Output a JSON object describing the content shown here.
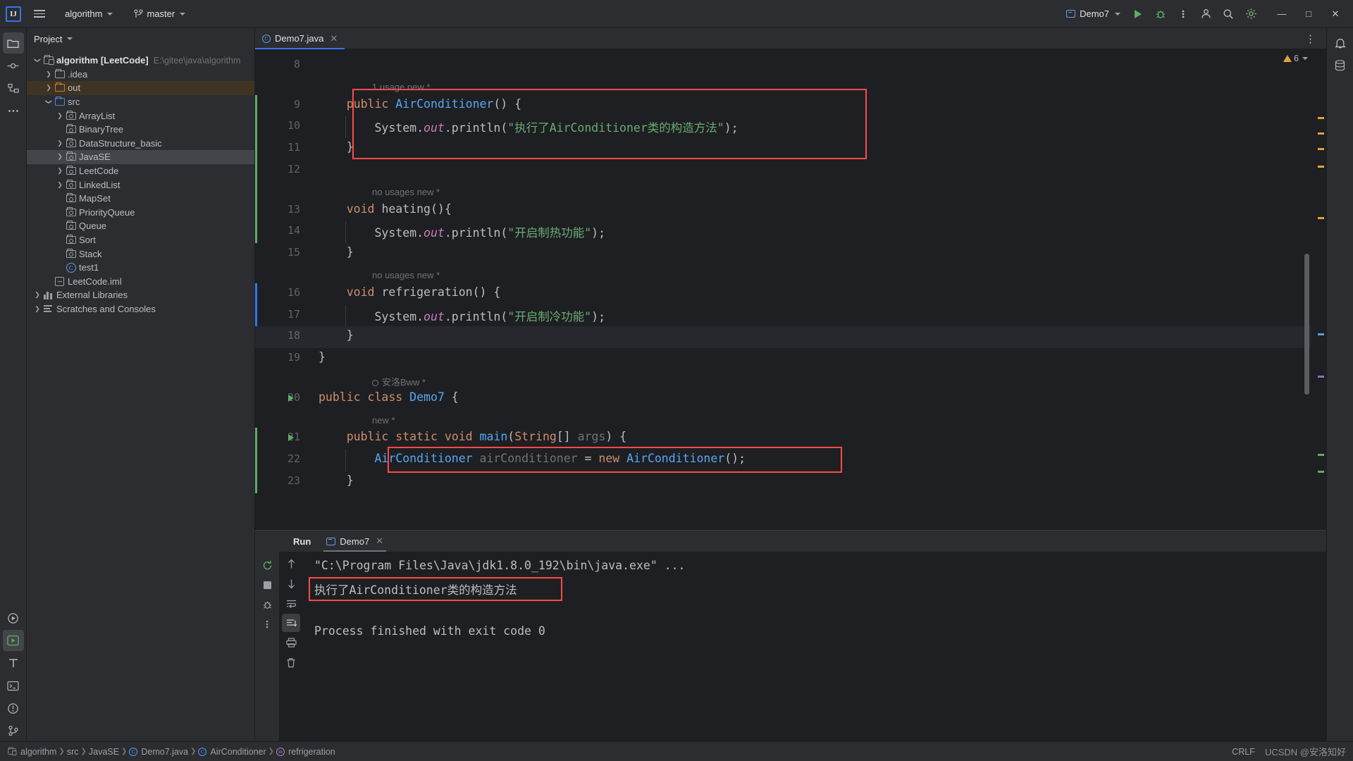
{
  "toolbar": {
    "logo": "IJ",
    "menu_icon": "hamburger-icon",
    "project_name": "algorithm",
    "branch_icon": "vcs-branch-icon",
    "branch_name": "master",
    "run_config": "Demo7",
    "run_icon": "run-icon",
    "debug_icon": "debug-icon",
    "more_icon": "more-vertical-icon",
    "account_icon": "account-icon",
    "search_icon": "search-icon",
    "settings_icon": "settings-icon",
    "minimize": "—",
    "maximize": "□",
    "close": "✕"
  },
  "left_rail": {
    "items": [
      {
        "name": "project-tool-icon",
        "glyph": "folder"
      },
      {
        "name": "commit-tool-icon",
        "glyph": "commit"
      },
      {
        "name": "structure-tool-icon",
        "glyph": "structure"
      },
      {
        "name": "more-tool-icon",
        "glyph": "dots"
      }
    ],
    "bottom_items": [
      {
        "name": "run-tool-icon",
        "glyph": "play-circle"
      },
      {
        "name": "run-active-icon",
        "glyph": "play-box"
      },
      {
        "name": "todo-tool-icon",
        "glyph": "T"
      },
      {
        "name": "terminal-tool-icon",
        "glyph": "terminal"
      },
      {
        "name": "problems-tool-icon",
        "glyph": "excl-circle"
      },
      {
        "name": "git-tool-icon",
        "glyph": "git"
      }
    ]
  },
  "right_rail": {
    "items": [
      {
        "name": "notifications-icon",
        "glyph": "bell"
      },
      {
        "name": "database-icon",
        "glyph": "db"
      }
    ]
  },
  "project_panel": {
    "title": "Project",
    "tree": [
      {
        "depth": 0,
        "arrow": "down",
        "icon": "module-icon",
        "label": "algorithm [LeetCode]",
        "bold": true,
        "sub": "E:\\gitee\\java\\algorithm",
        "state": "normal"
      },
      {
        "depth": 1,
        "arrow": "right",
        "icon": "folder-gray",
        "label": ".idea",
        "state": "normal"
      },
      {
        "depth": 1,
        "arrow": "right",
        "icon": "folder-orange",
        "label": "out",
        "state": "excluded"
      },
      {
        "depth": 1,
        "arrow": "down",
        "icon": "folder-blue",
        "label": "src",
        "state": "normal"
      },
      {
        "depth": 2,
        "arrow": "right",
        "icon": "package-icon",
        "label": "ArrayList",
        "state": "normal"
      },
      {
        "depth": 2,
        "arrow": "none",
        "icon": "package-icon",
        "label": "BinaryTree",
        "state": "normal"
      },
      {
        "depth": 2,
        "arrow": "right",
        "icon": "package-icon",
        "label": "DataStructure_basic",
        "state": "normal"
      },
      {
        "depth": 2,
        "arrow": "right",
        "icon": "package-icon",
        "label": "JavaSE",
        "state": "selected"
      },
      {
        "depth": 2,
        "arrow": "right",
        "icon": "package-icon",
        "label": "LeetCode",
        "state": "normal"
      },
      {
        "depth": 2,
        "arrow": "right",
        "icon": "package-icon",
        "label": "LinkedList",
        "state": "normal"
      },
      {
        "depth": 2,
        "arrow": "none",
        "icon": "package-icon",
        "label": "MapSet",
        "state": "normal"
      },
      {
        "depth": 2,
        "arrow": "none",
        "icon": "package-icon",
        "label": "PriorityQueue",
        "state": "normal"
      },
      {
        "depth": 2,
        "arrow": "none",
        "icon": "package-icon",
        "label": "Queue",
        "state": "normal"
      },
      {
        "depth": 2,
        "arrow": "none",
        "icon": "package-icon",
        "label": "Sort",
        "state": "normal"
      },
      {
        "depth": 2,
        "arrow": "none",
        "icon": "package-icon",
        "label": "Stack",
        "state": "normal"
      },
      {
        "depth": 2,
        "arrow": "none",
        "icon": "class-icon",
        "label": "test1",
        "state": "normal"
      },
      {
        "depth": 1,
        "arrow": "none",
        "icon": "iml-icon",
        "label": "LeetCode.iml",
        "state": "normal"
      },
      {
        "depth": 0,
        "arrow": "right",
        "icon": "library-icon",
        "label": "External Libraries",
        "state": "normal"
      },
      {
        "depth": 0,
        "arrow": "right",
        "icon": "scratch-icon",
        "label": "Scratches and Consoles",
        "state": "normal"
      }
    ]
  },
  "editor": {
    "tab": {
      "label": "Demo7.java",
      "icon": "java-class-icon",
      "close": "✕"
    },
    "options_icon": "editor-options-icon",
    "warning_count": "6",
    "warning_icon": "warning-triangle-icon",
    "lines": [
      {
        "num": "8",
        "text": ""
      },
      {
        "hint": "1 usage   new *"
      },
      {
        "num": "9",
        "text": "    public AirConditioner() {"
      },
      {
        "num": "10",
        "text": "        System.out.println(\"执行了AirConditioner类的构造方法\");"
      },
      {
        "num": "11",
        "text": "    }"
      },
      {
        "num": "12",
        "text": ""
      },
      {
        "hint": "no usages   new *"
      },
      {
        "num": "13",
        "text": "    void heating(){"
      },
      {
        "num": "14",
        "text": "        System.out.println(\"开启制热功能\");"
      },
      {
        "num": "15",
        "text": "    }"
      },
      {
        "hint": "no usages   new *"
      },
      {
        "num": "16",
        "text": "    void refrigeration() {"
      },
      {
        "num": "17",
        "text": "        System.out.println(\"开启制冷功能\");"
      },
      {
        "num": "18",
        "text": "    }"
      },
      {
        "num": "19",
        "text": "}"
      },
      {
        "hint": "安洛Bww *",
        "author": true
      },
      {
        "num": "20",
        "text": "public class Demo7 {",
        "runmark": true
      },
      {
        "hint": "new *"
      },
      {
        "num": "21",
        "text": "    public static void main(String[] args) {",
        "runmark": true
      },
      {
        "num": "22",
        "text": "        AirConditioner airConditioner = new AirConditioner();"
      },
      {
        "num": "23",
        "text": "    }"
      }
    ]
  },
  "run_panel": {
    "title": "Run",
    "tab_label": "Demo7",
    "tab_icon": "run-config-icon",
    "tab_close": "✕",
    "toolbar_icons": [
      "rerun-icon",
      "stop-icon",
      "debug-icon",
      "more-vertical-icon"
    ],
    "side_icons": [
      "scroll-up-icon",
      "scroll-down-icon",
      "soft-wrap-icon",
      "scroll-to-end-icon",
      "print-icon",
      "clear-all-icon"
    ],
    "console": [
      {
        "text": "\"C:\\Program Files\\Java\\jdk1.8.0_192\\bin\\java.exe\" ...",
        "type": "cmd"
      },
      {
        "text": "执行了AirConditioner类的构造方法",
        "type": "out",
        "highlight": true
      },
      {
        "text": "",
        "type": "out"
      },
      {
        "text": "Process finished with exit code 0",
        "type": "out"
      }
    ]
  },
  "statusbar": {
    "breadcrumbs": [
      {
        "label": "algorithm",
        "icon": "module-icon"
      },
      {
        "label": "src",
        "icon": "none"
      },
      {
        "label": "JavaSE",
        "icon": "none"
      },
      {
        "label": "Demo7.java",
        "icon": "class-icon"
      },
      {
        "label": "AirConditioner",
        "icon": "class-icon"
      },
      {
        "label": "refrigeration",
        "icon": "method-icon"
      }
    ],
    "line_sep": "CRLF",
    "watermark": "UCSDN @安洛知好"
  },
  "colors": {
    "accent": "#3574f0",
    "run_green": "#5fad65",
    "highlight_red": "#ff4a4a",
    "string_green": "#6aab73",
    "keyword_orange": "#cf8e6d",
    "type_blue": "#56a8f5",
    "bg_editor": "#1e1f22",
    "bg_panel": "#2b2d30"
  }
}
